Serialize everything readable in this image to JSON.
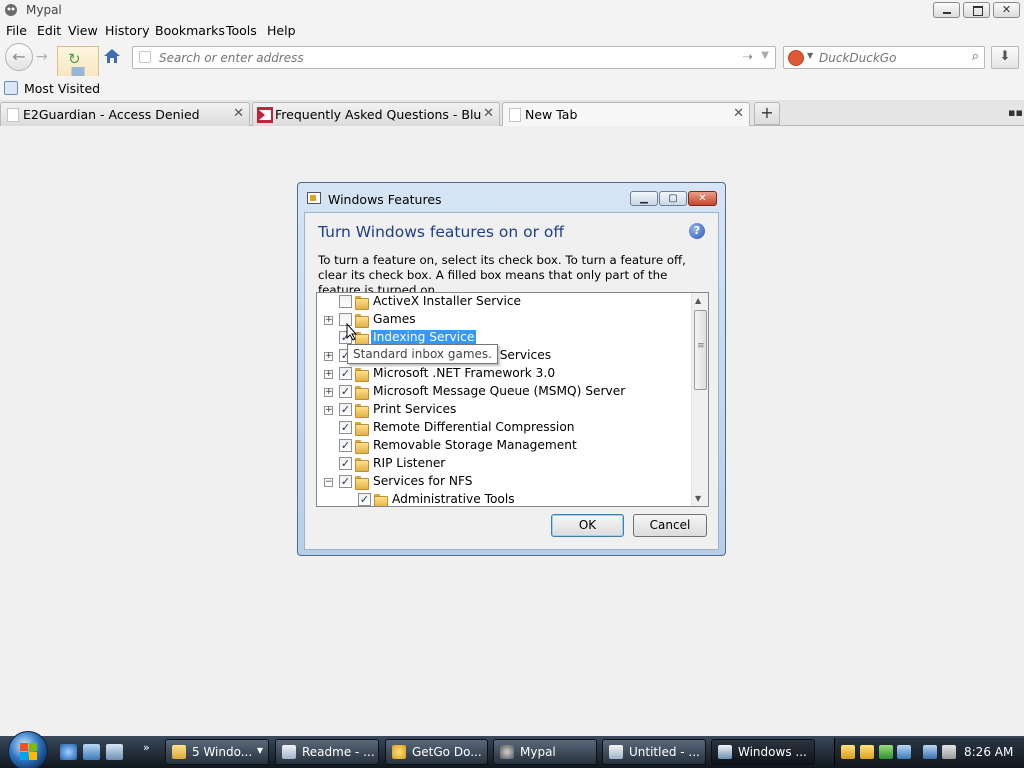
{
  "browser": {
    "window_title": "Mypal",
    "menu": [
      "File",
      "Edit",
      "View",
      "History",
      "Bookmarks",
      "Tools",
      "Help"
    ],
    "address_placeholder": "Search or enter address",
    "search_engine": "DuckDuckGo",
    "search_placeholder": "DuckDuckGo",
    "bookmarks": [
      "Most Visited"
    ],
    "tabs": [
      {
        "label": "E2Guardian - Access Denied",
        "active": false
      },
      {
        "label": "Frequently Asked Questions - BlueMa...",
        "active": false
      },
      {
        "label": "New Tab",
        "active": true
      }
    ]
  },
  "dialog": {
    "title": "Windows Features",
    "heading": "Turn Windows features on or off",
    "description": "To turn a feature on, select its check box. To turn a feature off, clear its check box. A filled box means that only part of the feature is turned on.",
    "features": [
      {
        "label": "ActiveX Installer Service",
        "checked": false,
        "expander": "",
        "indent": 0
      },
      {
        "label": "Games",
        "checked": false,
        "expander": "+",
        "indent": 0
      },
      {
        "label": "Indexing Service",
        "checked": true,
        "expander": "",
        "indent": 0,
        "selected": true
      },
      {
        "label": "Internet Information Services",
        "checked": true,
        "expander": "+",
        "indent": 0
      },
      {
        "label": "Microsoft .NET Framework 3.0",
        "checked": true,
        "expander": "+",
        "indent": 0
      },
      {
        "label": "Microsoft Message Queue (MSMQ) Server",
        "checked": true,
        "expander": "+",
        "indent": 0
      },
      {
        "label": "Print Services",
        "checked": true,
        "expander": "+",
        "indent": 0
      },
      {
        "label": "Remote Differential Compression",
        "checked": true,
        "expander": "",
        "indent": 0
      },
      {
        "label": "Removable Storage Management",
        "checked": true,
        "expander": "",
        "indent": 0
      },
      {
        "label": "RIP Listener",
        "checked": true,
        "expander": "",
        "indent": 0
      },
      {
        "label": "Services for NFS",
        "checked": true,
        "expander": "−",
        "indent": 0
      },
      {
        "label": "Administrative Tools",
        "checked": true,
        "expander": "",
        "indent": 1
      }
    ],
    "tooltip": "Standard inbox games.",
    "ok_label": "OK",
    "cancel_label": "Cancel"
  },
  "taskbar": {
    "buttons": [
      {
        "label": "5 Windo...",
        "has_arrow": true,
        "active": false
      },
      {
        "label": "Readme - ...",
        "has_arrow": false,
        "active": false
      },
      {
        "label": "GetGo Do...",
        "has_arrow": false,
        "active": false
      },
      {
        "label": "Mypal",
        "has_arrow": false,
        "active": false
      },
      {
        "label": "Untitled - ...",
        "has_arrow": false,
        "active": false
      },
      {
        "label": "Windows ...",
        "has_arrow": false,
        "active": true
      }
    ],
    "clock": "8:26 AM"
  },
  "colors": {
    "selection": "#3399ff",
    "dialog_heading": "#1e3f8a",
    "taskbar": "#1e2834"
  }
}
